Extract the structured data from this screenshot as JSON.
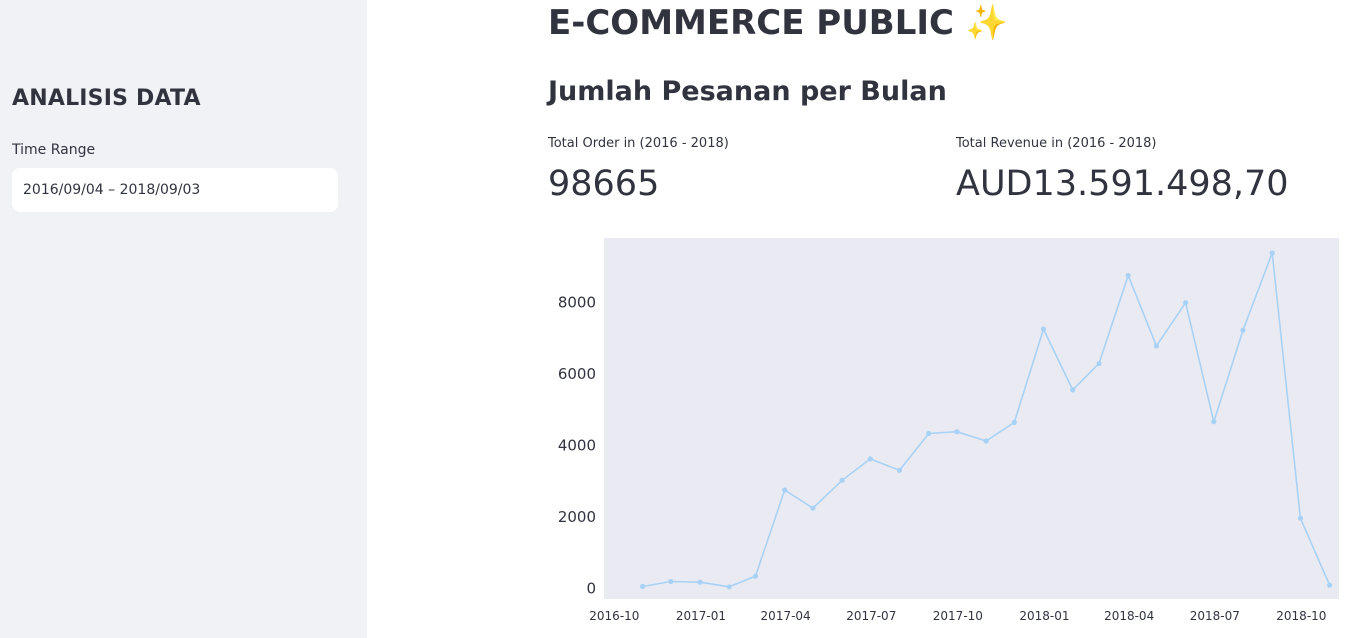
{
  "sidebar": {
    "title": "ANALISIS DATA",
    "time_range_label": "Time Range",
    "time_range_value": "2016/09/04 – 2018/09/03"
  },
  "main": {
    "title": "E-COMMERCE PUBLIC",
    "title_icon": "✨",
    "subtitle": "Jumlah Pesanan per Bulan",
    "metrics": [
      {
        "label": "Total Order in (2016 - 2018)",
        "value": "98665"
      },
      {
        "label": "Total Revenue in (2016 - 2018)",
        "value": "AUD13.591.498,70"
      }
    ]
  },
  "colors": {
    "line": "#a8d2f5",
    "plot_bg": "#eaeaf2",
    "sidebar_bg": "#f0f2f6"
  },
  "chart_data": {
    "type": "line",
    "title": "",
    "xlabel": "",
    "ylabel": "",
    "ylim": [
      -300,
      9800
    ],
    "xlim": [
      "2016-09-20",
      "2018-11-10"
    ],
    "x_ticks": [
      "2016-10",
      "2017-01",
      "2017-04",
      "2017-07",
      "2017-10",
      "2018-01",
      "2018-04",
      "2018-07",
      "2018-10"
    ],
    "y_ticks": [
      0,
      2000,
      4000,
      6000,
      8000
    ],
    "grid": false,
    "series": [
      {
        "x": [
          "2016-10-31",
          "2016-11-30",
          "2016-12-31",
          "2017-01-31",
          "2017-02-28",
          "2017-03-31",
          "2017-04-30",
          "2017-05-31",
          "2017-06-30",
          "2017-07-31",
          "2017-08-31",
          "2017-09-30",
          "2017-10-31",
          "2017-11-30",
          "2017-12-31",
          "2018-01-31",
          "2018-02-28",
          "2018-03-31",
          "2018-04-30",
          "2018-05-31",
          "2018-06-30",
          "2018-07-31",
          "2018-08-31",
          "2018-09-30",
          "2018-10-31"
        ],
        "values": [
          50,
          190,
          170,
          40,
          340,
          2750,
          2240,
          3020,
          3620,
          3300,
          4330,
          4380,
          4120,
          4640,
          7250,
          5550,
          6290,
          8750,
          6780,
          7990,
          4660,
          7220,
          9380,
          1960,
          90
        ]
      }
    ]
  }
}
